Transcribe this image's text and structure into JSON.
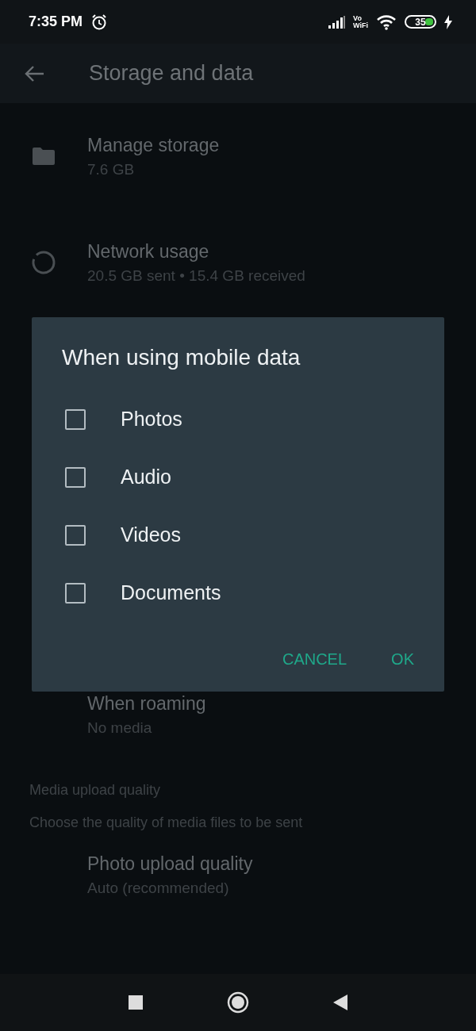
{
  "status_bar": {
    "time": "7:35 PM",
    "vowifi": [
      "Vo",
      "WiFi"
    ],
    "battery": "35"
  },
  "app_bar": {
    "title": "Storage and data"
  },
  "settings": [
    {
      "kind": "storage",
      "title": "Manage storage",
      "subtitle": "7.6 GB"
    },
    {
      "kind": "network",
      "title": "Network usage",
      "subtitle": "20.5 GB sent • 15.4 GB received"
    }
  ],
  "roaming": {
    "title": "When roaming",
    "subtitle": "No media"
  },
  "upload_section": {
    "header": "Media upload quality",
    "description": "Choose the quality of media files to be sent",
    "items": [
      {
        "title": "Photo upload quality",
        "subtitle": "Auto (recommended)"
      }
    ]
  },
  "dialog": {
    "title": "When using mobile data",
    "options": [
      {
        "label": "Photos",
        "checked": false
      },
      {
        "label": "Audio",
        "checked": false
      },
      {
        "label": "Videos",
        "checked": false
      },
      {
        "label": "Documents",
        "checked": false
      }
    ],
    "buttons": [
      "CANCEL",
      "OK"
    ]
  }
}
